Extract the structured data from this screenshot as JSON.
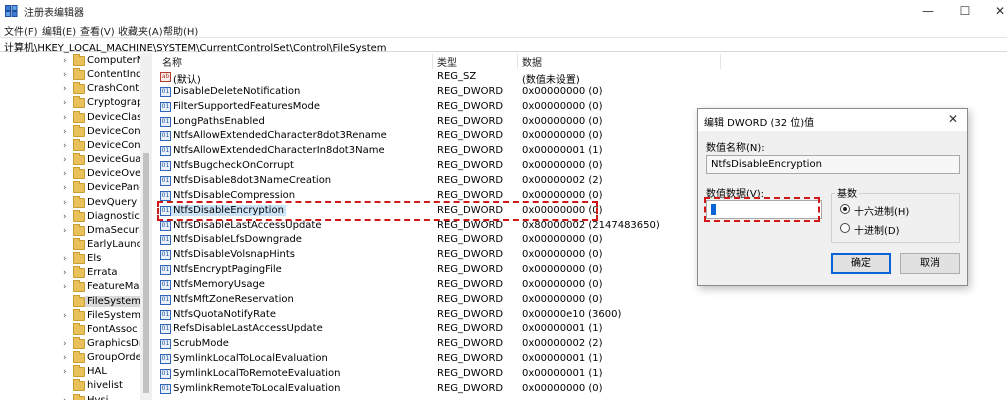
{
  "window": {
    "title": "注册表编辑器",
    "controls": {
      "minimize": "—",
      "maximize": "☐",
      "close": "✕"
    }
  },
  "menu": [
    "文件(F)",
    "编辑(E)",
    "查看(V)",
    "收藏夹(A)",
    "帮助(H)"
  ],
  "address": "计算机\\HKEY_LOCAL_MACHINE\\SYSTEM\\CurrentControlSet\\Control\\FileSystem",
  "tree": {
    "items": [
      {
        "label": "ComputerNa",
        "expandable": true
      },
      {
        "label": "ContentIndex",
        "expandable": true
      },
      {
        "label": "CrashControl",
        "expandable": true
      },
      {
        "label": "Cryptograph",
        "expandable": true
      },
      {
        "label": "DeviceClasse",
        "expandable": true
      },
      {
        "label": "DeviceContai",
        "expandable": true
      },
      {
        "label": "DeviceContai",
        "expandable": true
      },
      {
        "label": "DeviceGuard",
        "expandable": true
      },
      {
        "label": "DeviceOverri",
        "expandable": true
      },
      {
        "label": "DevicePanels",
        "expandable": true
      },
      {
        "label": "DevQuery",
        "expandable": true
      },
      {
        "label": "Diagnostics",
        "expandable": true
      },
      {
        "label": "DmaSecurity",
        "expandable": true
      },
      {
        "label": "EarlyLaunch",
        "expandable": false
      },
      {
        "label": "Els",
        "expandable": true
      },
      {
        "label": "Errata",
        "expandable": true
      },
      {
        "label": "FeatureMana",
        "expandable": true
      },
      {
        "label": "FileSystem",
        "expandable": false,
        "selected": true
      },
      {
        "label": "FileSystemUti",
        "expandable": true
      },
      {
        "label": "FontAssoc",
        "expandable": false
      },
      {
        "label": "GraphicsDriv",
        "expandable": true
      },
      {
        "label": "GroupOrderI",
        "expandable": true
      },
      {
        "label": "HAL",
        "expandable": true
      },
      {
        "label": "hivelist",
        "expandable": false
      },
      {
        "label": "Hvsi",
        "expandable": true
      }
    ]
  },
  "list": {
    "columns": [
      "名称",
      "类型",
      "数据"
    ],
    "rows": [
      {
        "icon": "ab",
        "name": "(默认)",
        "type": "REG_SZ",
        "data": "(数值未设置)"
      },
      {
        "icon": "01",
        "name": "DisableDeleteNotification",
        "type": "REG_DWORD",
        "data": "0x00000000 (0)"
      },
      {
        "icon": "01",
        "name": "FilterSupportedFeaturesMode",
        "type": "REG_DWORD",
        "data": "0x00000000 (0)"
      },
      {
        "icon": "01",
        "name": "LongPathsEnabled",
        "type": "REG_DWORD",
        "data": "0x00000000 (0)"
      },
      {
        "icon": "01",
        "name": "NtfsAllowExtendedCharacter8dot3Rename",
        "type": "REG_DWORD",
        "data": "0x00000000 (0)"
      },
      {
        "icon": "01",
        "name": "NtfsAllowExtendedCharacterIn8dot3Name",
        "type": "REG_DWORD",
        "data": "0x00000001 (1)"
      },
      {
        "icon": "01",
        "name": "NtfsBugcheckOnCorrupt",
        "type": "REG_DWORD",
        "data": "0x00000000 (0)"
      },
      {
        "icon": "01",
        "name": "NtfsDisable8dot3NameCreation",
        "type": "REG_DWORD",
        "data": "0x00000002 (2)"
      },
      {
        "icon": "01",
        "name": "NtfsDisableCompression",
        "type": "REG_DWORD",
        "data": "0x00000000 (0)"
      },
      {
        "icon": "01",
        "name": "NtfsDisableEncryption",
        "type": "REG_DWORD",
        "data": "0x00000000 (0)",
        "selected": true
      },
      {
        "icon": "01",
        "name": "NtfsDisableLastAccessUpdate",
        "type": "REG_DWORD",
        "data": "0x80000002 (2147483650)"
      },
      {
        "icon": "01",
        "name": "NtfsDisableLfsDowngrade",
        "type": "REG_DWORD",
        "data": "0x00000000 (0)"
      },
      {
        "icon": "01",
        "name": "NtfsDisableVolsnapHints",
        "type": "REG_DWORD",
        "data": "0x00000000 (0)"
      },
      {
        "icon": "01",
        "name": "NtfsEncryptPagingFile",
        "type": "REG_DWORD",
        "data": "0x00000000 (0)"
      },
      {
        "icon": "01",
        "name": "NtfsMemoryUsage",
        "type": "REG_DWORD",
        "data": "0x00000000 (0)"
      },
      {
        "icon": "01",
        "name": "NtfsMftZoneReservation",
        "type": "REG_DWORD",
        "data": "0x00000000 (0)"
      },
      {
        "icon": "01",
        "name": "NtfsQuotaNotifyRate",
        "type": "REG_DWORD",
        "data": "0x00000e10 (3600)"
      },
      {
        "icon": "01",
        "name": "RefsDisableLastAccessUpdate",
        "type": "REG_DWORD",
        "data": "0x00000001 (1)"
      },
      {
        "icon": "01",
        "name": "ScrubMode",
        "type": "REG_DWORD",
        "data": "0x00000002 (2)"
      },
      {
        "icon": "01",
        "name": "SymlinkLocalToLocalEvaluation",
        "type": "REG_DWORD",
        "data": "0x00000001 (1)"
      },
      {
        "icon": "01",
        "name": "SymlinkLocalToRemoteEvaluation",
        "type": "REG_DWORD",
        "data": "0x00000001 (1)"
      },
      {
        "icon": "01",
        "name": "SymlinkRemoteToLocalEvaluation",
        "type": "REG_DWORD",
        "data": "0x00000000 (0)"
      }
    ]
  },
  "dialog": {
    "title": "编辑 DWORD (32 位)值",
    "close": "✕",
    "name_label": "数值名称(N):",
    "name_value": "NtfsDisableEncryption",
    "data_label": "数值数据(V):",
    "data_value": "",
    "base_label": "基数",
    "radio_hex": "十六进制(H)",
    "radio_dec": "十进制(D)",
    "ok": "确定",
    "cancel": "取消"
  },
  "colors": {
    "highlight": "#d01818",
    "selection": "#cce4f7",
    "accent": "#0a64d8"
  }
}
